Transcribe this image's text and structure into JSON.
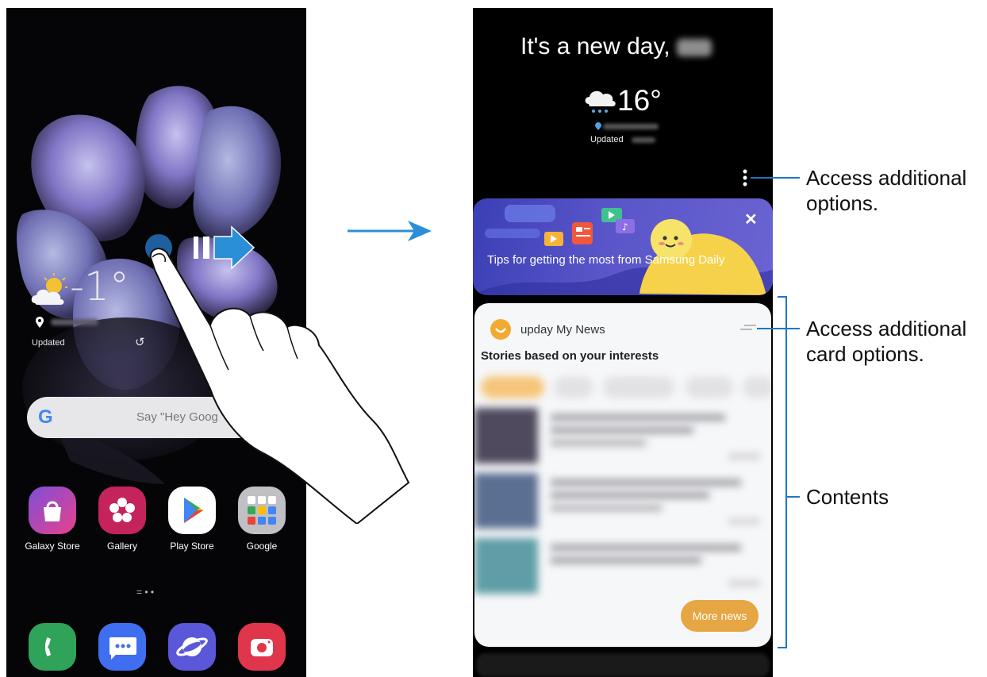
{
  "left_phone": {
    "weather": {
      "temperature": "-1°",
      "updated_label": "Updated",
      "icon": "partly-cloudy-icon"
    },
    "search": {
      "google_letter": "G",
      "placeholder": "Say \"Hey Goog"
    },
    "apps": [
      {
        "label": "Galaxy Store",
        "icon": "galaxy-store-icon",
        "color": "#c93a8f"
      },
      {
        "label": "Gallery",
        "icon": "gallery-icon",
        "color": "#c4245b"
      },
      {
        "label": "Play Store",
        "icon": "play-store-icon",
        "color": "#ffffff"
      },
      {
        "label": "Google",
        "icon": "google-folder-icon",
        "color": "#bfbfc4"
      }
    ],
    "page_indicator": "= • •",
    "dock": [
      {
        "icon": "phone-icon",
        "color": "#2fa35a"
      },
      {
        "icon": "messages-icon",
        "color": "#3f6ff0"
      },
      {
        "icon": "internet-icon",
        "color": "#5a57d9"
      },
      {
        "icon": "camera-icon",
        "color": "#e0364b"
      }
    ]
  },
  "right_phone": {
    "greeting": "It's a new day,",
    "weather": {
      "temperature": "16°",
      "updated_label": "Updated",
      "icon": "rain-cloud-icon"
    },
    "tips_card": {
      "text": "Tips for getting the most from Samsung Daily",
      "close": "✕"
    },
    "news_card": {
      "source": "upday My News",
      "title": "Stories based on your interests",
      "more_button": "More news"
    }
  },
  "annotations": {
    "options": "Access additional options.",
    "card_options": "Access additional card options.",
    "contents": "Contents"
  },
  "colors": {
    "arrow": "#2a8fd6",
    "annotation_line": "#1f78c0"
  }
}
